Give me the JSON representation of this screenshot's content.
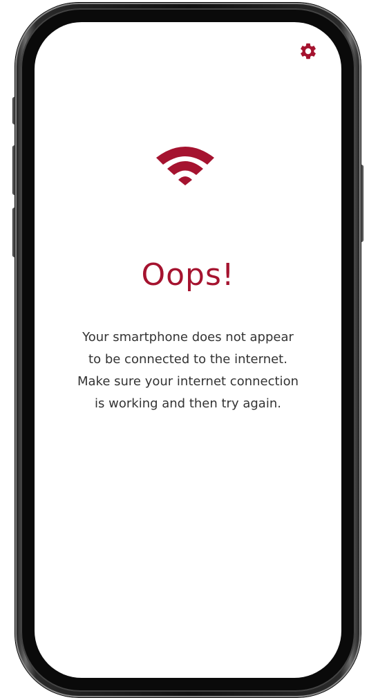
{
  "colors": {
    "accent": "#a5132f",
    "text": "#333333",
    "screen_bg": "#ffffff",
    "frame": "#111111"
  },
  "header": {
    "settings_icon": "gear-icon"
  },
  "status": {
    "icon": "wifi-icon",
    "title": "Oops!",
    "message_lines": [
      "Your smartphone does not appear",
      "to be connected to the internet.",
      "Make sure your internet connection",
      "is working and then try again."
    ]
  }
}
